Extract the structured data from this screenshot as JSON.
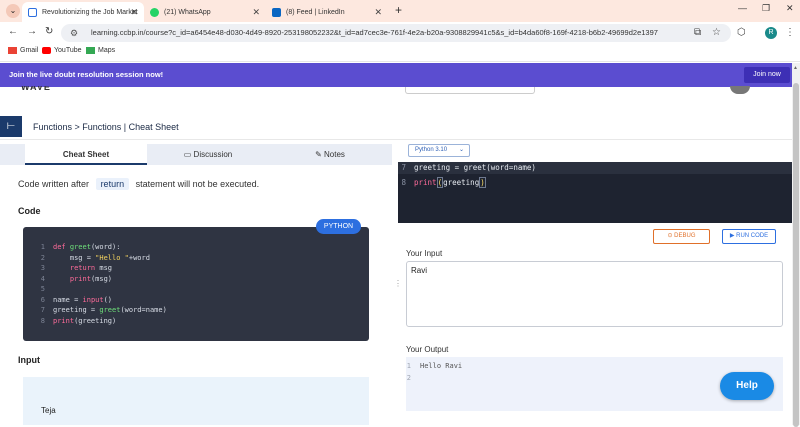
{
  "browser": {
    "tabs": [
      {
        "title": "Revolutionizing the Job Market",
        "close": "✕"
      },
      {
        "title": "(21) WhatsApp",
        "close": "✕"
      },
      {
        "title": "(8) Feed | LinkedIn",
        "close": "✕"
      }
    ],
    "new_tab": "+",
    "url": "learning.ccbp.in/course?c_id=a6454e48-d030-4d49-8920-253198052232&t_id=ad7cec3e-761f-4e2a-b20a-9308829941c5&s_id=b4da60f8-169f-4218-b6b2-49699d2e1397",
    "profile_initial": "R",
    "bookmarks": [
      "Gmail",
      "YouTube",
      "Maps"
    ]
  },
  "banner": {
    "text": "Join the live doubt resolution session now!",
    "button": "Join now"
  },
  "header": {
    "logo": "WAVE"
  },
  "breadcrumb": "Functions > Functions | Cheat Sheet",
  "left_panel": {
    "tabs": [
      "Cheat Sheet",
      "Discussion",
      "Notes"
    ],
    "note_before": "Code written after",
    "note_keyword": "return",
    "note_after": "statement will not be executed.",
    "code_heading": "Code",
    "code_badge": "PYTHON",
    "code_lines": [
      {
        "n": "1",
        "text": "def greet(word):"
      },
      {
        "n": "2",
        "text": "    msg = \"Hello \"+word"
      },
      {
        "n": "3",
        "text": "    return msg"
      },
      {
        "n": "4",
        "text": "    print(msg)"
      },
      {
        "n": "5",
        "text": ""
      },
      {
        "n": "6",
        "text": "name = input()"
      },
      {
        "n": "7",
        "text": "greeting = greet(word=name)"
      },
      {
        "n": "8",
        "text": "print(greeting)"
      }
    ],
    "input_heading": "Input",
    "input_value": "Teja"
  },
  "right_panel": {
    "language": "Python 3.10",
    "editor_lines": [
      {
        "n": "7",
        "text": "greeting = greet(word=name)"
      },
      {
        "n": "8",
        "text": "print(greeting)"
      }
    ],
    "debug_label": "DEBUG",
    "run_label": "RUN CODE",
    "your_input_label": "Your Input",
    "your_input_value": "Ravi",
    "your_output_label": "Your Output",
    "output_lines": [
      {
        "n": "1",
        "text": "Hello Ravi"
      },
      {
        "n": "2",
        "text": ""
      }
    ],
    "help_label": "Help"
  },
  "colors": {
    "banner": "#5b4dd0",
    "accent": "#1b3a6b",
    "run": "#2d6fe0",
    "debug": "#e0702a",
    "help": "#1a8ae5"
  }
}
